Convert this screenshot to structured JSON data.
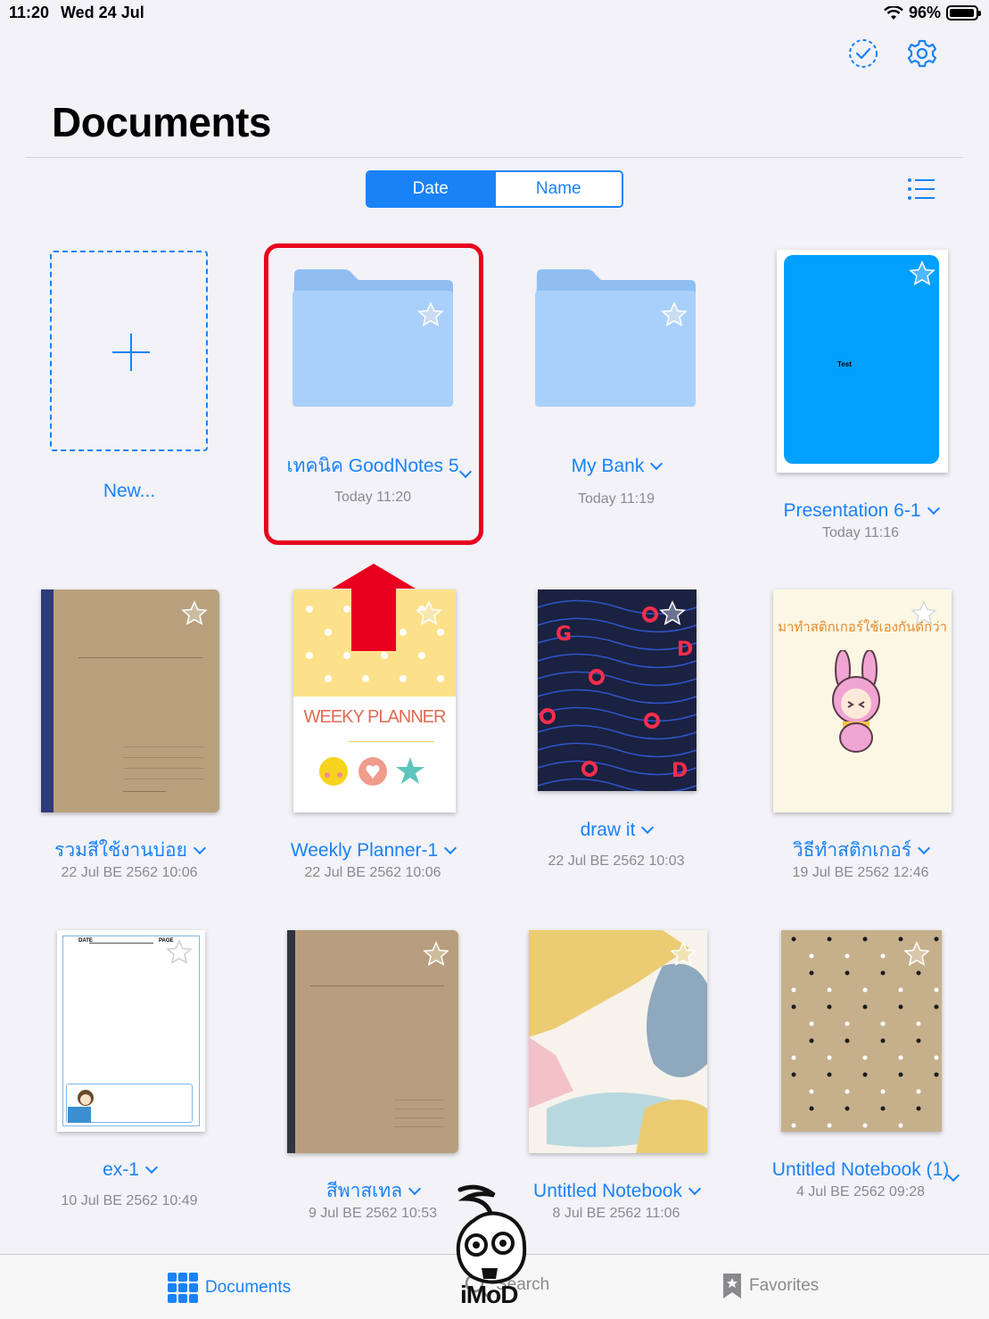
{
  "status_bar": {
    "time": "11:20",
    "date": "Wed 24 Jul",
    "battery": "96%"
  },
  "header": {
    "title": "Documents"
  },
  "sort": {
    "options": [
      "Date",
      "Name"
    ],
    "selected": "Date"
  },
  "items": [
    {
      "name": "New...",
      "date": ""
    },
    {
      "name": "เทคนิค GoodNotes 5",
      "date": "Today 11:20"
    },
    {
      "name": "My Bank",
      "date": "Today 11:19"
    },
    {
      "name": "Presentation 6-1",
      "date": "Today 11:16",
      "cover_text": "Test"
    },
    {
      "name": "รวมสีใช้งานบ่อย",
      "date": "22 Jul BE 2562 10:06"
    },
    {
      "name": "Weekly Planner-1",
      "date": "22 Jul BE 2562 10:06",
      "cover_text": "WEEKY PLANNER"
    },
    {
      "name": "draw it",
      "date": "22 Jul BE 2562 10:03"
    },
    {
      "name": "วิธีทำสติกเกอร์",
      "date": "19 Jul BE 2562 12:46",
      "cover_text": "มาทำสติกเกอร์ใช้เองกันดีกว่า"
    },
    {
      "name": "ex-1",
      "date": "10 Jul BE 2562 10:49",
      "cover_text_date": "DATE",
      "cover_text_page": "PAGE"
    },
    {
      "name": "สีพาสเทล",
      "date": "9 Jul BE 2562 10:53"
    },
    {
      "name": "Untitled Notebook",
      "date": "8 Jul BE 2562 11:06"
    },
    {
      "name": "Untitled Notebook (1)",
      "date": "4 Jul BE 2562 09:28"
    }
  ],
  "tab_bar": {
    "documents": "Documents",
    "search": "Search",
    "favorites": "Favorites"
  },
  "watermark": "iMoD",
  "colors": {
    "accent": "#1a82f7",
    "highlight": "#e8001e",
    "folder": "#a9d0fb"
  }
}
